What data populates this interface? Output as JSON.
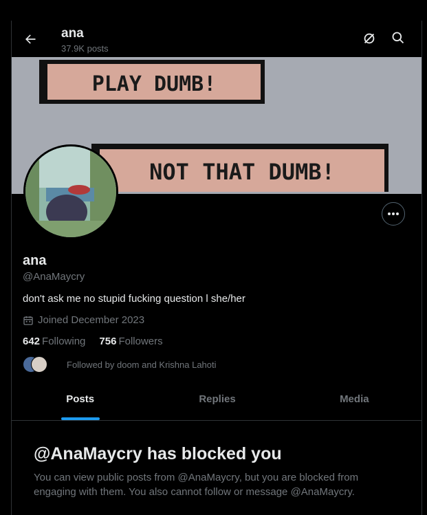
{
  "header": {
    "name": "ana",
    "posts_count": "37.9K posts",
    "back_icon": "arrow-left-icon",
    "grok_icon": "grok-icon",
    "search_icon": "search-icon"
  },
  "banner": {
    "panel_top_text": "PLAY DUMB!",
    "panel_bottom_text": "NOT THAT DUMB!"
  },
  "profile": {
    "display_name": "ana",
    "handle": "@AnaMaycry",
    "bio": "don't ask me no stupid fucking question l she/her",
    "joined": "Joined December 2023",
    "following_count": "642",
    "following_label": "Following",
    "followers_count": "756",
    "followers_label": "Followers",
    "followed_by": "Followed by doom and Krishna Lahoti"
  },
  "tabs": [
    {
      "label": "Posts",
      "active": true
    },
    {
      "label": "Replies",
      "active": false
    },
    {
      "label": "Media",
      "active": false
    }
  ],
  "blocked": {
    "title": "@AnaMaycry has blocked you",
    "message": "You can view public posts from @AnaMaycry, but you are blocked from engaging with them. You also cannot follow or message @AnaMaycry."
  },
  "colors": {
    "background": "#000000",
    "text_primary": "#e7e9ea",
    "text_secondary": "#71767b",
    "accent": "#1d9bf0",
    "border": "#2f3336"
  }
}
